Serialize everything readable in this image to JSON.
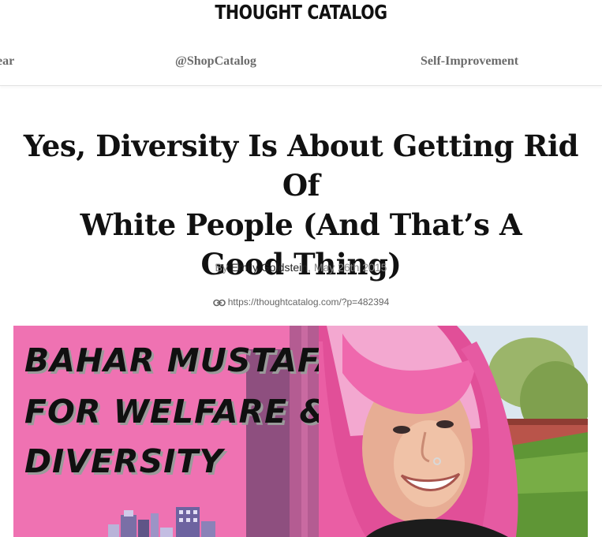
{
  "header": {
    "logo": "THOUGHT CATALOG",
    "nav": [
      {
        "label": "ear"
      },
      {
        "label": "@ShopCatalog"
      },
      {
        "label": "Self-Improvement"
      }
    ]
  },
  "article": {
    "title_lines": [
      "Yes, Diversity Is About Getting Rid Of",
      "White People (And That’s A",
      "Good Thing)"
    ],
    "byline": {
      "prefix": "By ",
      "author": "Emily Goldstein",
      "separator": ", ",
      "date": "May 26th 2015"
    },
    "permalink": "https://thoughtcatalog.com/?p=482394",
    "permalink_icon": "link-icon"
  },
  "featured_image": {
    "banner_lines": [
      "BAHAR MUSTAFA",
      "FOR WELFARE &",
      "DIVERSITY"
    ],
    "colors": {
      "pink": "#ef72b2",
      "hair": "#e9589f"
    }
  }
}
